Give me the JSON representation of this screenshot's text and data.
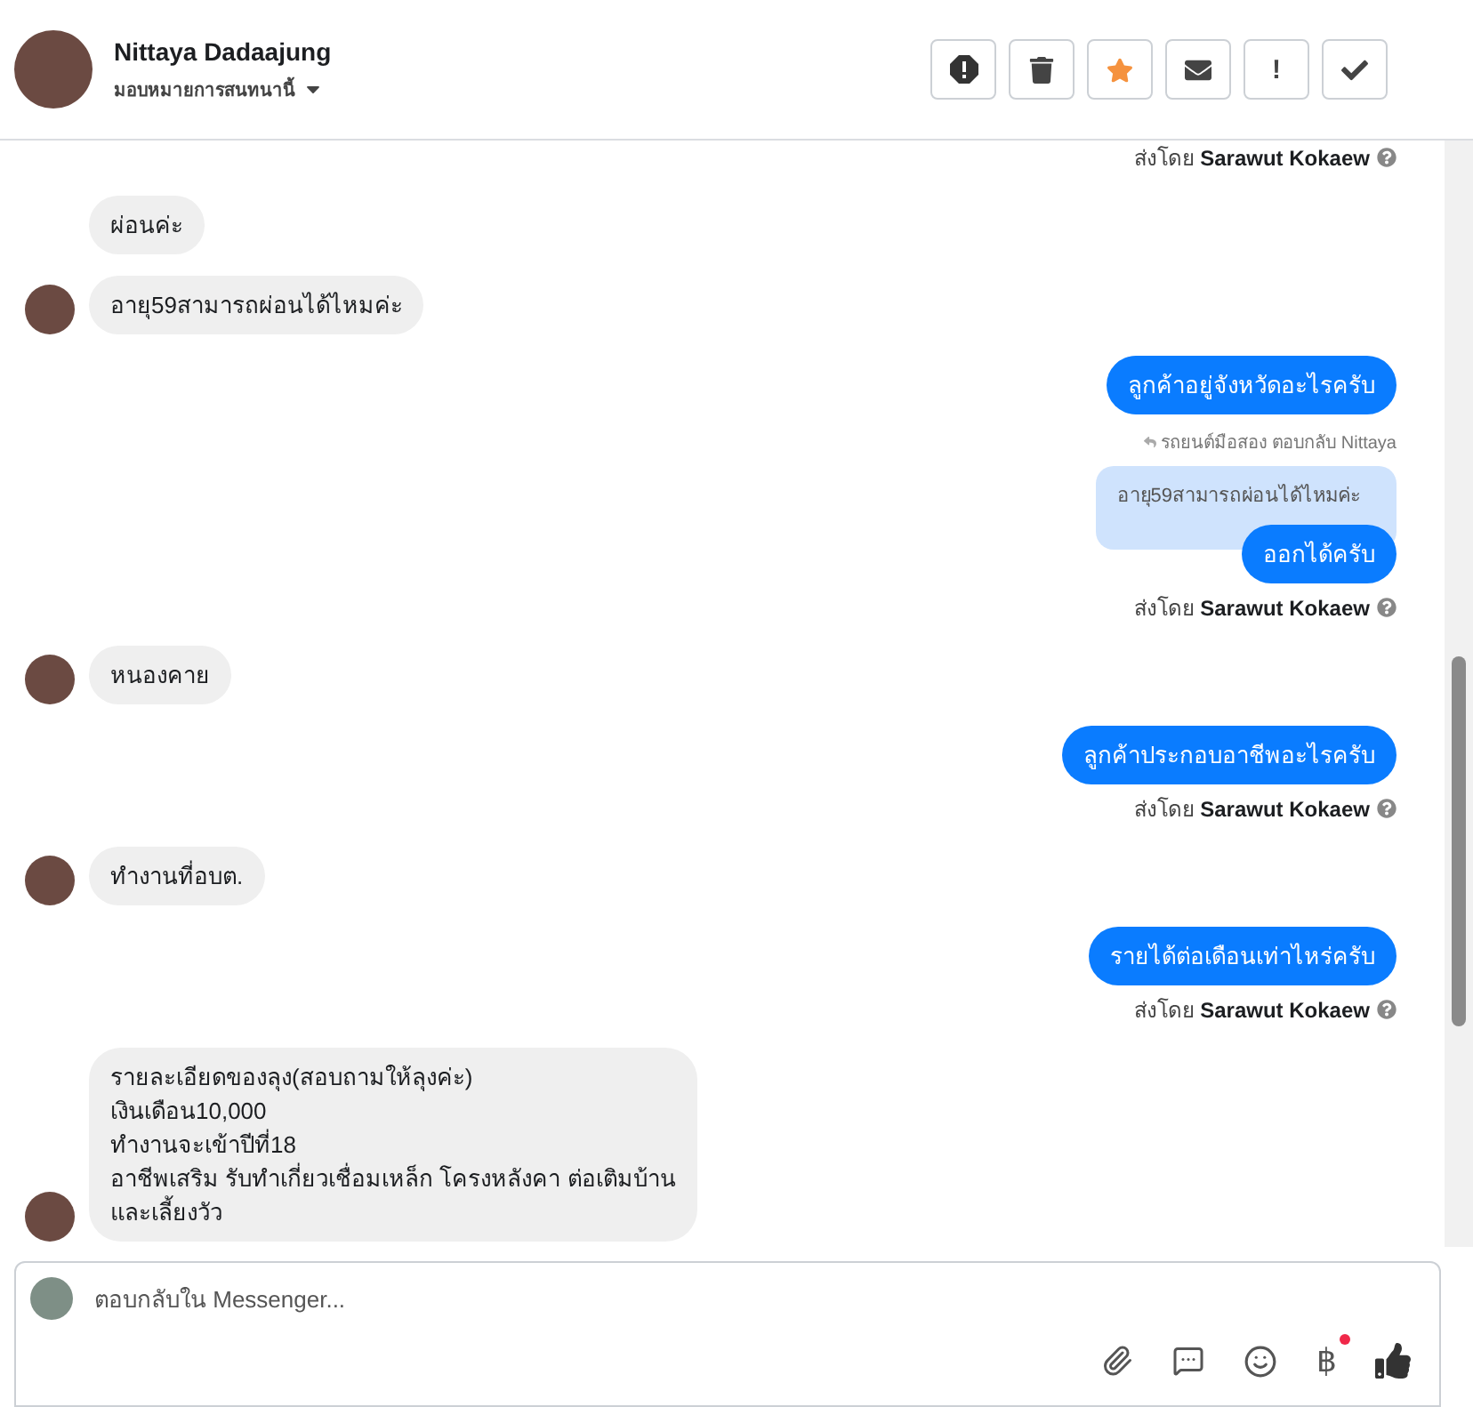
{
  "header": {
    "name": "Nittaya Dadaajung",
    "subtitle": "มอบหมายการสนทนานี้",
    "actions": [
      {
        "kind": "spam"
      },
      {
        "kind": "delete"
      },
      {
        "kind": "star",
        "on": true
      },
      {
        "kind": "unread"
      },
      {
        "kind": "important",
        "label": "!"
      },
      {
        "kind": "done"
      }
    ]
  },
  "messages": [
    {
      "kind": "note",
      "prefix": "ส่งโดย",
      "sender": "Sarawut Kokaew"
    },
    {
      "kind": "incoming",
      "text": "ผ่อนค่ะ",
      "avatar": false
    },
    {
      "kind": "incoming",
      "text": "อายุ59สามารถผ่อนได้ไหมค่ะ",
      "avatar": true
    },
    {
      "kind": "outgoing",
      "text": "ลูกค้าอยู่จังหวัดอะไรครับ"
    },
    {
      "kind": "reply",
      "context": "รถยนต์มือสอง ตอบกลับ Nittaya",
      "quote": "อายุ59สามารถผ่อนได้ไหมค่ะ",
      "text": "ออกได้ครับ"
    },
    {
      "kind": "note",
      "prefix": "ส่งโดย",
      "sender": "Sarawut Kokaew"
    },
    {
      "kind": "incoming",
      "text": "หนองคาย",
      "avatar": true
    },
    {
      "kind": "outgoing",
      "text": "ลูกค้าประกอบอาชีพอะไรครับ"
    },
    {
      "kind": "note",
      "prefix": "ส่งโดย",
      "sender": "Sarawut Kokaew"
    },
    {
      "kind": "incoming",
      "text": "ทำงานที่อบต.",
      "avatar": true
    },
    {
      "kind": "outgoing",
      "text": "รายได้ต่อเดือนเท่าไหร่ครับ"
    },
    {
      "kind": "note",
      "prefix": "ส่งโดย",
      "sender": "Sarawut Kokaew"
    },
    {
      "kind": "incoming",
      "text": "รายละเอียดของลุง(สอบถามให้ลุงค่ะ)\nเงินเดือน10,000\nทำงานจะเข้าปีที่18\nอาชีพเสริม รับทำเกี่ยวเชื่อมเหล็ก โครงหลังคา ต่อเติมบ้าน\nและเลี้ยงวัว",
      "avatar": true
    }
  ],
  "composer": {
    "placeholder": "ตอบกลับใน Messenger...",
    "tools": [
      {
        "kind": "attach"
      },
      {
        "kind": "saved-reply"
      },
      {
        "kind": "emoji"
      },
      {
        "kind": "payment",
        "label": "฿",
        "badge": true
      },
      {
        "kind": "like"
      }
    ]
  }
}
